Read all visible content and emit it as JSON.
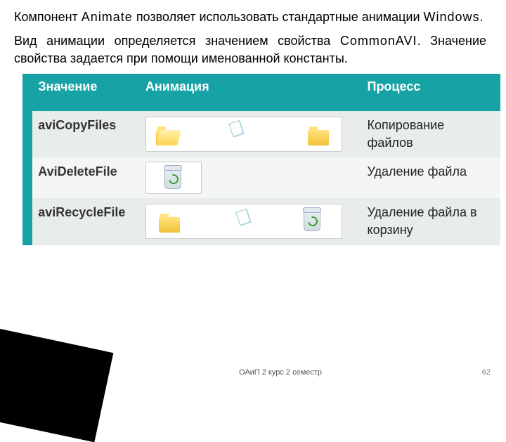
{
  "paragraphs": {
    "p1_a": "Компонент ",
    "p1_b": "Animate",
    "p1_c": " позволяет использовать стандартные анимации ",
    "p1_d": "Windows",
    "p1_e": ".",
    "p2_a": "Вид анимации определяется значением свойства ",
    "p2_b": "CommonAVI",
    "p2_c": ". Значение свойства задается при помощи именованной константы."
  },
  "table": {
    "headers": {
      "value": "Значение",
      "anim": "Анимация",
      "proc": "Процесс"
    },
    "rows": [
      {
        "value": "aviCopyFiles",
        "proc": "Копирование файлов",
        "kind": "copy"
      },
      {
        "value": "AviDeleteFile",
        "proc": "Удаление файла",
        "kind": "delete"
      },
      {
        "value": "aviRecycleFile",
        "proc": "Удаление файла в корзину",
        "kind": "recycle"
      }
    ]
  },
  "footer": "ОАиП 2 курс 2 семестр",
  "page": "62"
}
